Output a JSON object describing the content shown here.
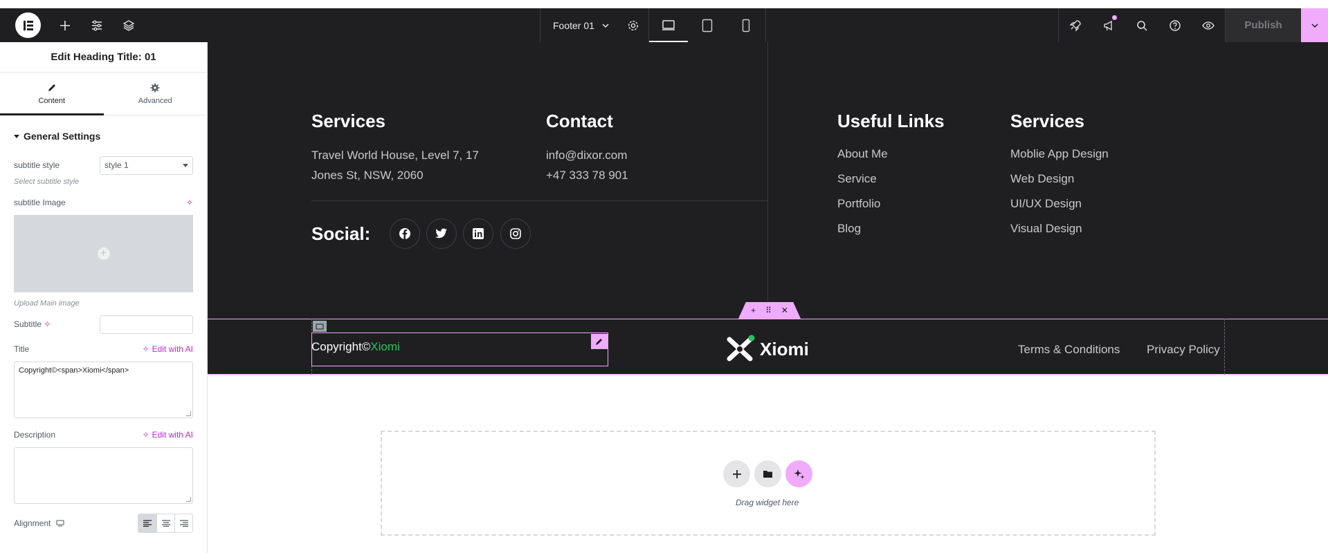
{
  "topbar": {
    "document_name": "Footer 01",
    "publish_label": "Publish"
  },
  "panel": {
    "title": "Edit Heading Title: 01",
    "tabs": [
      {
        "label": "Content",
        "icon": "pencil-icon"
      },
      {
        "label": "Advanced",
        "icon": "gear-icon"
      }
    ],
    "section_title": "General Settings",
    "subtitle_style_label": "subtitle style",
    "subtitle_style_value": "style 1",
    "subtitle_style_hint": "Select subtitle style",
    "subtitle_image_label": "subtitle Image",
    "upload_hint": "Upload Main image",
    "subtitle_label": "Subtitle",
    "subtitle_value": "",
    "title_label": "Title",
    "title_value": "Copyright©<span>Xiomi</span>",
    "edit_ai_label": "Edit with AI",
    "description_label": "Description",
    "description_value": "",
    "alignment_label": "Alignment"
  },
  "footer": {
    "services_heading": "Services",
    "address_line1": "Travel World House, Level 7, 17",
    "address_line2": "Jones St, NSW, 2060",
    "contact_heading": "Contact",
    "email": "info@dixor.com",
    "phone": "+47 333 78 901",
    "social_label": "Social:",
    "useful_heading": "Useful Links",
    "useful_links": [
      "About Me",
      "Service",
      "Portfolio",
      "Blog"
    ],
    "services2_heading": "Services",
    "services_links": [
      "Moblie App Design",
      "Web Design",
      "UI/UX Design",
      "Visual Design"
    ],
    "copyright_prefix": "Copyright©",
    "copyright_brand": "Xiomi",
    "logo_text": "Xiomi",
    "terms": "Terms & Conditions",
    "privacy": "Privacy Policy"
  },
  "dropzone": {
    "label": "Drag widget here"
  },
  "colors": {
    "accent": "#f0abfc",
    "dark": "#1f1f21",
    "brand_green": "#22c55e"
  }
}
